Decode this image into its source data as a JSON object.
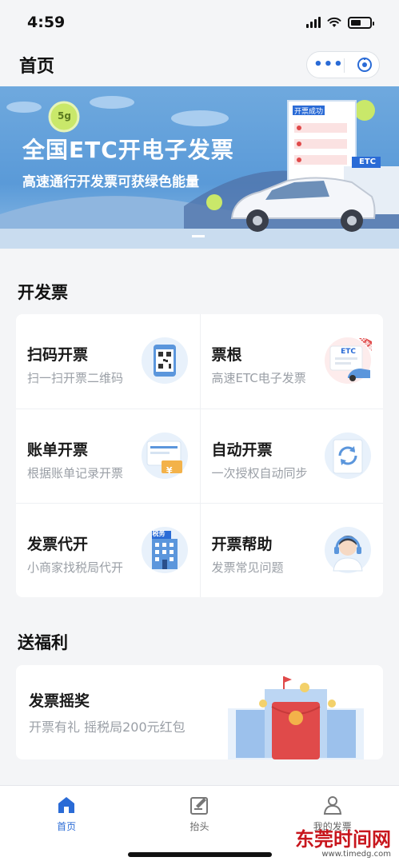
{
  "status_bar": {
    "time": "4:59"
  },
  "header": {
    "title": "首页",
    "menu_dots": "•••"
  },
  "banner": {
    "title": "全国ETC开电子发票",
    "subtitle": "高速通行开发票可获绿色能量",
    "badge_5g": "5g",
    "sign_text": "开票成功",
    "etc_sign": "ETC"
  },
  "invoice_section": {
    "title": "开发票",
    "items": [
      {
        "title": "扫码开票",
        "desc": "扫一扫开票二维码",
        "icon": "qr-code-icon"
      },
      {
        "title": "票根",
        "desc": "高速ETC电子发票",
        "icon": "etc-card-icon",
        "icon_label": "ETC",
        "corner_tag": "开发票"
      },
      {
        "title": "账单开票",
        "desc": "根据账单记录开票",
        "icon": "bill-icon",
        "icon_label": "¥"
      },
      {
        "title": "自动开票",
        "desc": "一次授权自动同步",
        "icon": "sync-icon"
      },
      {
        "title": "发票代开",
        "desc": "小商家找税局代开",
        "icon": "tax-office-icon",
        "icon_label": "税务"
      },
      {
        "title": "开票帮助",
        "desc": "发票常见问题",
        "icon": "support-agent-icon"
      }
    ]
  },
  "welfare_section": {
    "title": "送福利",
    "card": {
      "title": "发票摇奖",
      "desc": "开票有礼 摇税局200元红包"
    }
  },
  "tabbar": {
    "tabs": [
      {
        "label": "首页",
        "active": true
      },
      {
        "label": "抬头",
        "active": false
      },
      {
        "label": "我的发票",
        "active": false
      }
    ]
  },
  "watermark": {
    "main": "东莞时间网",
    "url": "www.timedg.com"
  },
  "colors": {
    "accent": "#2a6bd6",
    "banner": "#5a9ad8",
    "red": "#e04a4a"
  }
}
